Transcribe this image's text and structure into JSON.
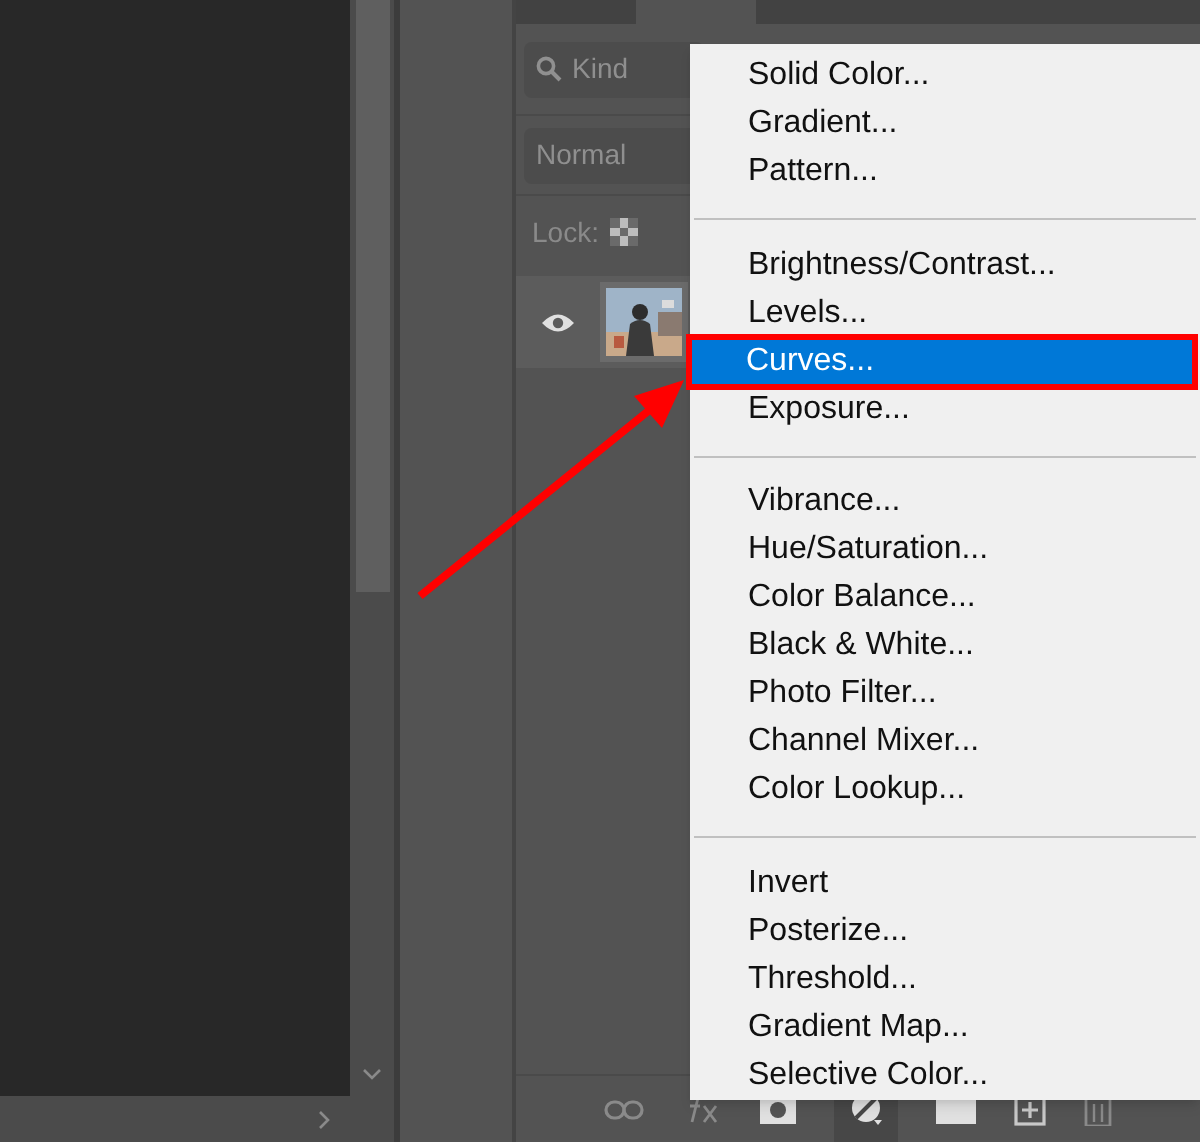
{
  "layers_panel": {
    "filter": {
      "placeholder": "Kind"
    },
    "blend_mode": {
      "value": "Normal"
    },
    "lock": {
      "label": "Lock:"
    },
    "layer": {
      "visible": true
    }
  },
  "menu": {
    "items": [
      {
        "kind": "item",
        "label": "Solid Color...",
        "selected": false
      },
      {
        "kind": "item",
        "label": "Gradient...",
        "selected": false
      },
      {
        "kind": "item",
        "label": "Pattern...",
        "selected": false
      },
      {
        "kind": "separator"
      },
      {
        "kind": "item",
        "label": "Brightness/Contrast...",
        "selected": false
      },
      {
        "kind": "item",
        "label": "Levels...",
        "selected": false
      },
      {
        "kind": "item",
        "label": "Curves...",
        "selected": true
      },
      {
        "kind": "item",
        "label": "Exposure...",
        "selected": false
      },
      {
        "kind": "separator"
      },
      {
        "kind": "item",
        "label": "Vibrance...",
        "selected": false
      },
      {
        "kind": "item",
        "label": "Hue/Saturation...",
        "selected": false
      },
      {
        "kind": "item",
        "label": "Color Balance...",
        "selected": false
      },
      {
        "kind": "item",
        "label": "Black & White...",
        "selected": false
      },
      {
        "kind": "item",
        "label": "Photo Filter...",
        "selected": false
      },
      {
        "kind": "item",
        "label": "Channel Mixer...",
        "selected": false
      },
      {
        "kind": "item",
        "label": "Color Lookup...",
        "selected": false
      },
      {
        "kind": "separator"
      },
      {
        "kind": "item",
        "label": "Invert",
        "selected": false
      },
      {
        "kind": "item",
        "label": "Posterize...",
        "selected": false
      },
      {
        "kind": "item",
        "label": "Threshold...",
        "selected": false
      },
      {
        "kind": "item",
        "label": "Gradient Map...",
        "selected": false
      },
      {
        "kind": "item",
        "label": "Selective Color...",
        "selected": false
      }
    ]
  }
}
